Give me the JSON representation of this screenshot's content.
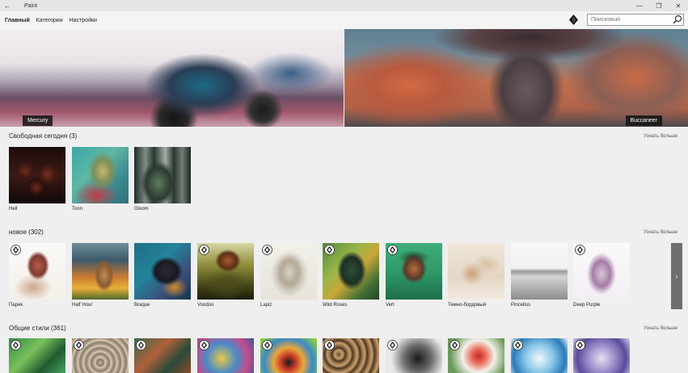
{
  "window": {
    "title": "Paint",
    "back_glyph": "←",
    "minimize_glyph": "—",
    "restore_glyph": "❐",
    "close_glyph": "✕"
  },
  "nav": {
    "items": [
      {
        "label": "Главный",
        "active": true
      },
      {
        "label": "Категории",
        "active": false
      },
      {
        "label": "Настройки",
        "active": false
      }
    ],
    "search_placeholder": "Поисковый"
  },
  "hero": {
    "left_label": "Mercury",
    "right_label": "Buccaneer"
  },
  "sections": [
    {
      "title": "Свободная сегодня (3)",
      "more": "Узнать больше",
      "tiles": [
        {
          "label": "Hell",
          "badge": false
        },
        {
          "label": "Toon",
          "badge": false
        },
        {
          "label": "Gloom",
          "badge": false
        }
      ]
    },
    {
      "title": "новое (302)",
      "more": "Узнать больше",
      "tiles": [
        {
          "label": "Парик",
          "badge": true
        },
        {
          "label": "Half Hour",
          "badge": false
        },
        {
          "label": "Braque",
          "badge": false
        },
        {
          "label": "Voodoo",
          "badge": true
        },
        {
          "label": "Lapiz",
          "badge": true
        },
        {
          "label": "Wild Roses",
          "badge": true
        },
        {
          "label": "Vert",
          "badge": true
        },
        {
          "label": "Темно-бордовый",
          "badge": false
        },
        {
          "label": "Pincellus",
          "badge": false
        },
        {
          "label": "Deep Purple",
          "badge": true
        }
      ]
    },
    {
      "title": "Общие стили (361)",
      "more": "Узнать больше",
      "tiles": [
        {
          "label": "",
          "badge": true
        },
        {
          "label": "",
          "badge": true
        },
        {
          "label": "",
          "badge": true
        },
        {
          "label": "",
          "badge": true
        },
        {
          "label": "",
          "badge": true
        },
        {
          "label": "",
          "badge": true
        },
        {
          "label": "",
          "badge": true
        },
        {
          "label": "",
          "badge": true
        },
        {
          "label": "",
          "badge": true
        },
        {
          "label": "",
          "badge": true
        }
      ]
    }
  ],
  "row_arrow": "›",
  "colors": {
    "accent": "#1a1a1a",
    "background": "#efefef"
  }
}
